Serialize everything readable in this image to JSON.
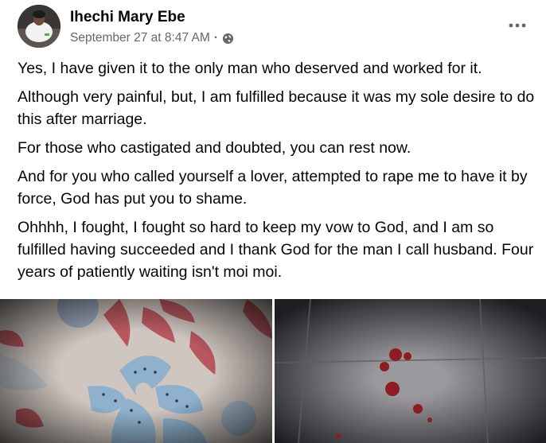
{
  "post": {
    "author": "Ihechi Mary Ebe",
    "timestamp": "September 27 at 8:47 AM",
    "separator": "·",
    "privacy_icon": "globe-icon",
    "more_icon": "more-options-icon",
    "paragraphs": [
      "Yes, I have given it to the only man who deserved and worked for it.",
      "Although very painful, but, I am fulfilled because it was my sole desire to do this after marriage.",
      "For those who castigated and doubted, you can rest now.",
      "And for you who called yourself a lover,  attempted to rape me to have it by force, God has put you to shame.",
      "Ohhhh, I fought, I fought so hard to keep my vow to God, and I am so fulfilled having succeeded and I thank God for the man I call husband. Four years of patiently waiting isn't moi moi."
    ],
    "photos": [
      {
        "description_icon": "floral-bedsheet-photo"
      },
      {
        "description_icon": "tiled-floor-photo"
      }
    ]
  },
  "colors": {
    "text_primary": "#050505",
    "text_secondary": "#65676b",
    "background": "#ffffff"
  }
}
